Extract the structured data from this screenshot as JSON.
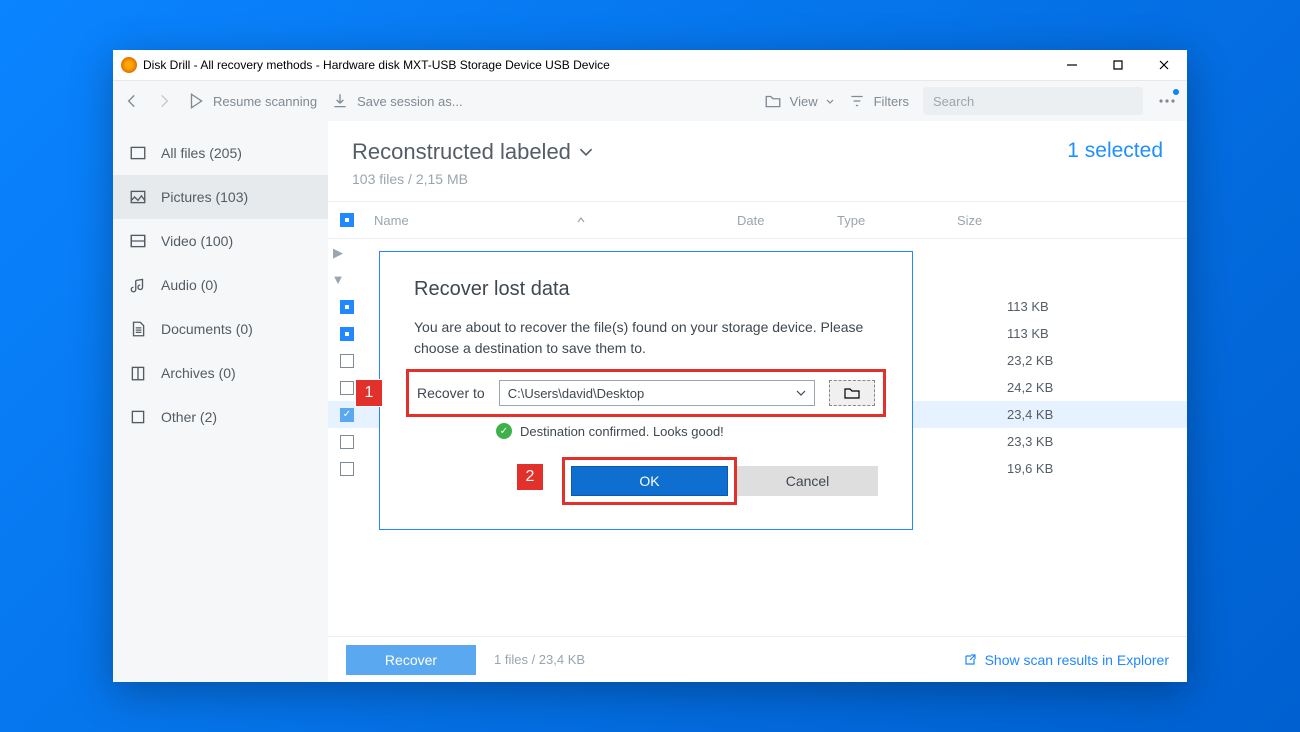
{
  "window": {
    "title": "Disk Drill - All recovery methods - Hardware disk MXT-USB Storage Device USB Device"
  },
  "toolbar": {
    "resume": "Resume scanning",
    "save": "Save session as...",
    "view": "View",
    "filters": "Filters",
    "search_placeholder": "Search"
  },
  "sidebar": {
    "items": [
      {
        "label": "All files (205)"
      },
      {
        "label": "Pictures (103)"
      },
      {
        "label": "Video (100)"
      },
      {
        "label": "Audio (0)"
      },
      {
        "label": "Documents (0)"
      },
      {
        "label": "Archives (0)"
      },
      {
        "label": "Other (2)"
      }
    ]
  },
  "main": {
    "title": "Reconstructed labeled",
    "sub": "103 files / 2,15 MB",
    "selected": "1 selected",
    "columns": {
      "name": "Name",
      "date": "Date",
      "type": "Type",
      "size": "Size"
    },
    "rows": [
      {
        "size": "113 KB"
      },
      {
        "size": "113 KB"
      },
      {
        "size": "23,2 KB"
      },
      {
        "size": "24,2 KB"
      },
      {
        "size": "23,4 KB"
      },
      {
        "size": "23,3 KB"
      },
      {
        "size": "19,6 KB"
      }
    ]
  },
  "footer": {
    "recover": "Recover",
    "info": "1 files / 23,4 KB",
    "scan_link": "Show scan results in Explorer"
  },
  "dialog": {
    "title": "Recover lost data",
    "text": "You are about to recover the file(s) found on your storage device. Please choose a destination to save them to.",
    "recover_to": "Recover to",
    "path": "C:\\Users\\david\\Desktop",
    "confirm": "Destination confirmed. Looks good!",
    "ok": "OK",
    "cancel": "Cancel",
    "annot1": "1",
    "annot2": "2"
  }
}
